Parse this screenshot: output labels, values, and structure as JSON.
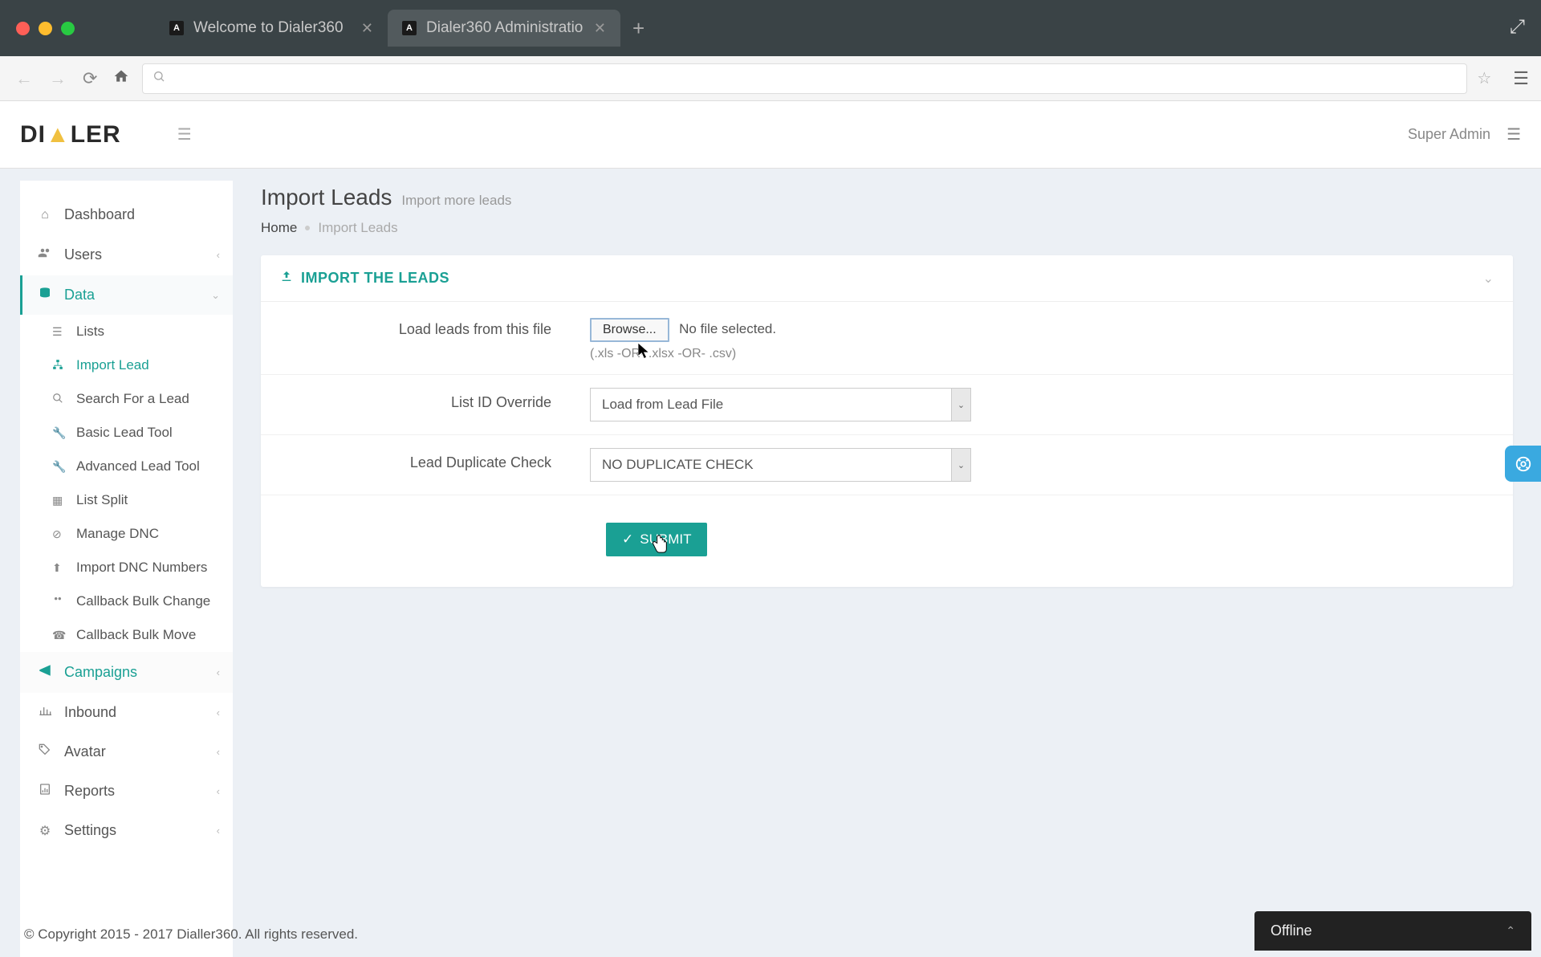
{
  "browser": {
    "tabs": [
      {
        "title": "Welcome to Dialer360"
      },
      {
        "title": "Dialer360 Administratio"
      }
    ]
  },
  "header": {
    "logo_left": "DI",
    "logo_right": "LER",
    "user_label": "Super Admin"
  },
  "sidebar": {
    "dashboard": "Dashboard",
    "users": "Users",
    "data": "Data",
    "data_items": {
      "lists": "Lists",
      "import_lead": "Import Lead",
      "search_lead": "Search For a Lead",
      "basic_tool": "Basic Lead Tool",
      "advanced_tool": "Advanced Lead Tool",
      "list_split": "List Split",
      "manage_dnc": "Manage DNC",
      "import_dnc": "Import DNC Numbers",
      "callback_change": "Callback Bulk Change",
      "callback_move": "Callback Bulk Move"
    },
    "campaigns": "Campaigns",
    "inbound": "Inbound",
    "avatar": "Avatar",
    "reports": "Reports",
    "settings": "Settings"
  },
  "page": {
    "title": "Import Leads",
    "subtitle": "Import more leads",
    "breadcrumb_home": "Home",
    "breadcrumb_current": "Import Leads"
  },
  "panel": {
    "title": "IMPORT THE LEADS",
    "fields": {
      "file_label": "Load leads from this file",
      "browse_button": "Browse...",
      "no_file": "No file selected.",
      "file_hint": "(.xls -OR- .xlsx -OR- .csv)",
      "list_id_label": "List ID Override",
      "list_id_value": "Load from Lead File",
      "dup_label": "Lead Duplicate Check",
      "dup_value": "NO DUPLICATE CHECK",
      "submit": "SUBMIT"
    }
  },
  "footer": {
    "copyright": "© Copyright 2015 - 2017 Dialler360. All rights reserved."
  },
  "chat": {
    "status": "Offline"
  }
}
